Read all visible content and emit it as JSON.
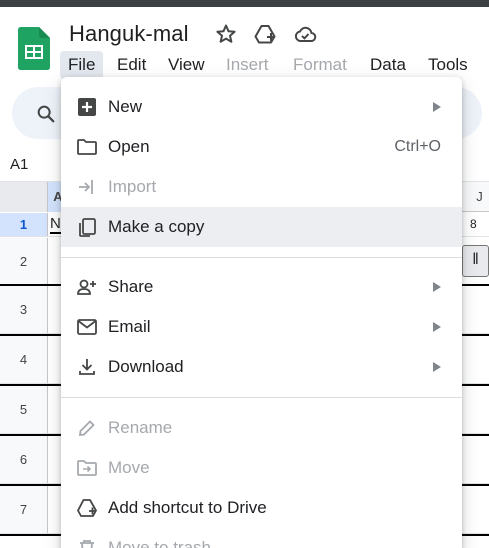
{
  "doc_title": "Hanguk-mal",
  "menu": [
    {
      "label": "File",
      "state": "active"
    },
    {
      "label": "Edit",
      "state": "enabled"
    },
    {
      "label": "View",
      "state": "enabled"
    },
    {
      "label": "Insert",
      "state": "disabled"
    },
    {
      "label": "Format",
      "state": "disabled"
    },
    {
      "label": "Data",
      "state": "enabled"
    },
    {
      "label": "Tools",
      "state": "enabled"
    }
  ],
  "name_box": "A1",
  "grid": {
    "col_a": "A",
    "col_j": "J",
    "row_numbers": [
      "1",
      "2",
      "3",
      "4",
      "5",
      "6",
      "7"
    ],
    "row1_col_a": "N",
    "row1_col_j": "8",
    "row2_col_j_control": "ǁ"
  },
  "file_menu": {
    "items": [
      {
        "label": "New",
        "icon": "plus-square-icon",
        "submenu": true,
        "disabled": false
      },
      {
        "label": "Open",
        "icon": "folder-icon",
        "shortcut": "Ctrl+O",
        "disabled": false
      },
      {
        "label": "Import",
        "icon": "import-icon",
        "disabled": true
      },
      {
        "label": "Make a copy",
        "icon": "copy-icon",
        "disabled": false,
        "highlighted": true
      },
      {
        "label": "Share",
        "icon": "share-person-icon",
        "submenu": true,
        "disabled": false
      },
      {
        "label": "Email",
        "icon": "mail-icon",
        "submenu": true,
        "disabled": false
      },
      {
        "label": "Download",
        "icon": "download-icon",
        "submenu": true,
        "disabled": false
      },
      {
        "label": "Rename",
        "icon": "pencil-icon",
        "disabled": true
      },
      {
        "label": "Move",
        "icon": "move-folder-icon",
        "disabled": true
      },
      {
        "label": "Add shortcut to Drive",
        "icon": "drive-shortcut-icon",
        "disabled": false
      },
      {
        "label": "Move to trash",
        "icon": "trash-icon",
        "disabled": true
      }
    ]
  },
  "colors": {
    "sheets_green": "#1ea362",
    "accent_blue": "#0b57d0",
    "disabled_text": "#a5a9ad"
  }
}
